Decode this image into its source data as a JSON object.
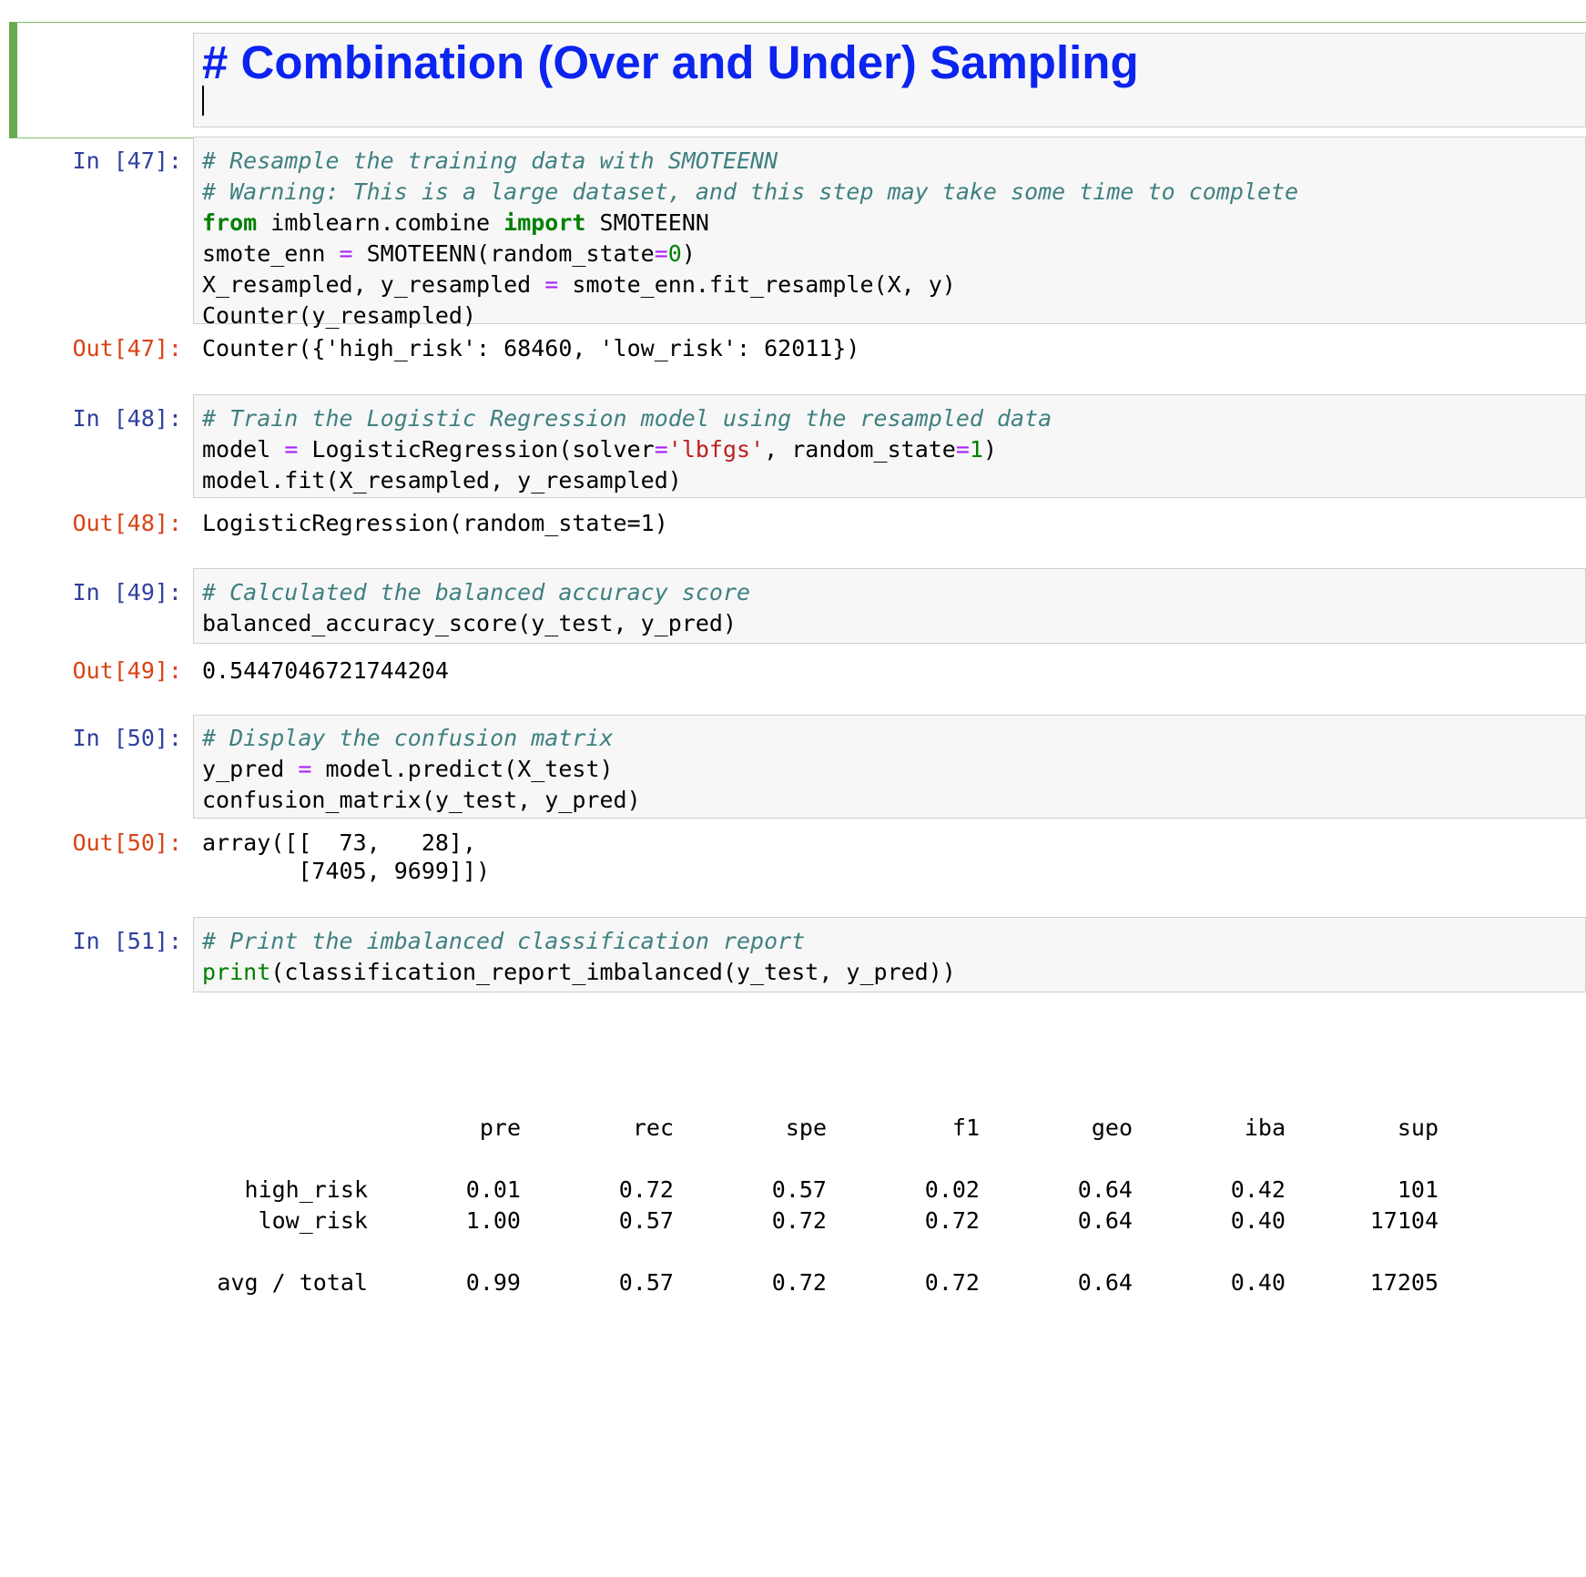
{
  "markdown_cell": {
    "text": "# Combination (Over and Under) Sampling"
  },
  "cells": {
    "c47": {
      "in_prompt": "In [47]:",
      "out_prompt": "Out[47]:",
      "output": "Counter({'high_risk': 68460, 'low_risk': 62011})"
    },
    "c48": {
      "in_prompt": "In [48]:",
      "out_prompt": "Out[48]:",
      "output": "LogisticRegression(random_state=1)"
    },
    "c49": {
      "in_prompt": "In [49]:",
      "out_prompt": "Out[49]:",
      "output": "0.5447046721744204"
    },
    "c50": {
      "in_prompt": "In [50]:",
      "out_prompt": "Out[50]:",
      "output_line1": "array([[  73,   28],",
      "output_line2": "       [7405, 9699]])"
    },
    "c51": {
      "in_prompt": "In [51]:"
    }
  },
  "code": {
    "c47": [
      [
        [
          "# Resample the training data with SMOTEENN",
          "comment"
        ]
      ],
      [
        [
          "# Warning: This is a large dataset, and this step may take some time to complete",
          "comment"
        ]
      ],
      [
        [
          "from",
          "keyword"
        ],
        [
          " imblearn.combine ",
          ""
        ],
        [
          "import",
          "keyword"
        ],
        [
          " SMOTEENN",
          ""
        ]
      ],
      [
        [
          "smote_enn ",
          ""
        ],
        [
          "=",
          "op"
        ],
        [
          " SMOTEENN(random_state",
          ""
        ],
        [
          "=",
          "op"
        ],
        [
          "0",
          "num"
        ],
        [
          ")",
          ""
        ]
      ],
      [
        [
          "X_resampled, y_resampled ",
          ""
        ],
        [
          "=",
          "op"
        ],
        [
          " smote_enn.fit_resample(X, y)",
          ""
        ]
      ],
      [
        [
          "Counter(y_resampled)",
          ""
        ]
      ]
    ],
    "c48": [
      [
        [
          "# Train the Logistic Regression model using the resampled data",
          "comment"
        ]
      ],
      [
        [
          "model ",
          ""
        ],
        [
          "=",
          "op"
        ],
        [
          " LogisticRegression(solver",
          ""
        ],
        [
          "=",
          "op"
        ],
        [
          "'lbfgs'",
          "str"
        ],
        [
          ", random_state",
          ""
        ],
        [
          "=",
          "op"
        ],
        [
          "1",
          "num"
        ],
        [
          ")",
          ""
        ]
      ],
      [
        [
          "model.fit(X_resampled, y_resampled)",
          ""
        ]
      ]
    ],
    "c49": [
      [
        [
          "# Calculated the balanced accuracy score",
          "comment"
        ]
      ],
      [
        [
          "balanced_accuracy_score(y_test, y_pred)",
          ""
        ]
      ]
    ],
    "c50": [
      [
        [
          "# Display the confusion matrix",
          "comment"
        ]
      ],
      [
        [
          "y_pred ",
          ""
        ],
        [
          "=",
          "op"
        ],
        [
          " model.predict(X_test)",
          ""
        ]
      ],
      [
        [
          "confusion_matrix(y_test, y_pred)",
          ""
        ]
      ]
    ],
    "c51": [
      [
        [
          "# Print the imbalanced classification report",
          "comment"
        ]
      ],
      [
        [
          "print",
          "builtin"
        ],
        [
          "(classification_report_imbalanced(y_test, y_pred))",
          ""
        ]
      ]
    ]
  },
  "report": {
    "headers": [
      "pre",
      "rec",
      "spe",
      "f1",
      "geo",
      "iba",
      "sup"
    ],
    "rows": [
      {
        "label": "high_risk",
        "values": [
          "0.01",
          "0.72",
          "0.57",
          "0.02",
          "0.64",
          "0.42",
          "101"
        ]
      },
      {
        "label": "low_risk",
        "values": [
          "1.00",
          "0.57",
          "0.72",
          "0.72",
          "0.64",
          "0.40",
          "17104"
        ]
      }
    ],
    "total": {
      "label": "avg / total",
      "values": [
        "0.99",
        "0.57",
        "0.72",
        "0.72",
        "0.64",
        "0.40",
        "17205"
      ]
    }
  }
}
